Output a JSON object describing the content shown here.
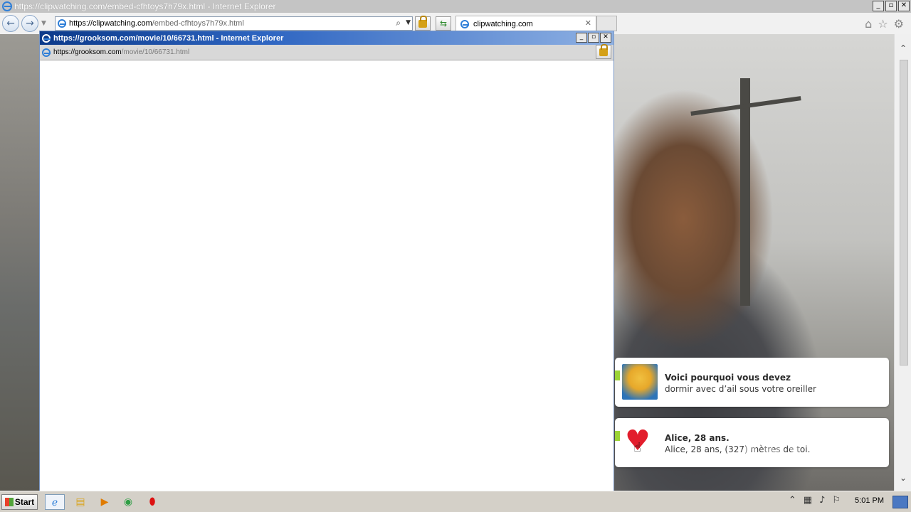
{
  "main_window": {
    "title": "https://clipwatching.com/embed-cfhtoys7h79x.html - Internet Explorer",
    "window_buttons": [
      "_",
      "▫",
      "✕"
    ]
  },
  "navbar": {
    "address_host": "https://clipwatching.com",
    "address_path": "/embed-cfhtoys7h79x.html",
    "tab_label": "clipwatching.com",
    "tab_close": "✕",
    "icons": [
      "home-icon",
      "star-icon",
      "gear-icon"
    ]
  },
  "popup": {
    "title": "https://grooksom.com/movie/10/66731.html - Internet Explorer",
    "address_host": "https://grooksom.com",
    "address_path": "/movie/10/66731.html",
    "window_buttons": [
      "_",
      "▫",
      "✕"
    ]
  },
  "notifications": [
    {
      "title": "Voici pourquoi vous devez",
      "body": "dormir avec d’ail sous votre oreiller",
      "thumb": "garlic-thumbnail"
    },
    {
      "title": "Alice, 28 ans.",
      "body": "Alice, 28 ans, (327) mètres de toi.",
      "thumb": "heart-thumbnail"
    }
  ],
  "watermark": "ANY RUN",
  "taskbar": {
    "start_label": "Start",
    "items": [
      "ie-icon",
      "explorer-icon",
      "media-player-icon",
      "chrome-icon",
      "opera-icon"
    ],
    "clock": "5:01 PM"
  }
}
